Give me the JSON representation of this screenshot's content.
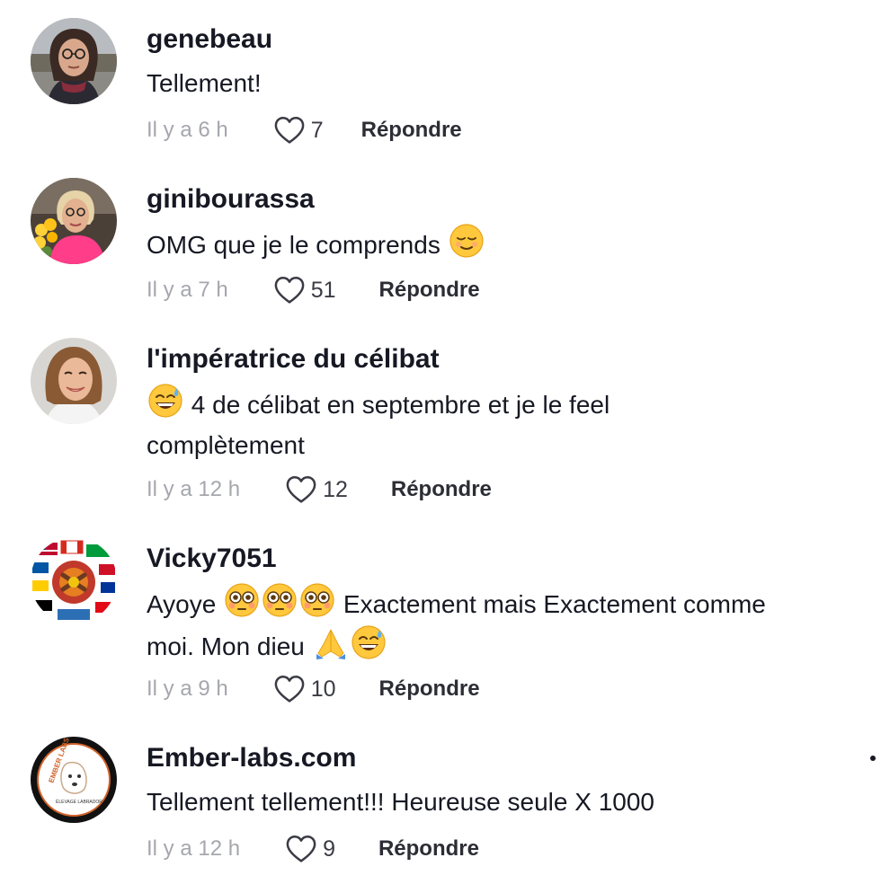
{
  "colors": {
    "text": "#161823",
    "secondary": "#a5a7ad",
    "reply": "#2c2d35"
  },
  "comments": [
    {
      "username": "genebeau",
      "text": [
        "Tellement!"
      ],
      "time": "Il y a 6 h",
      "likes": "7",
      "reply": "Répondre",
      "avatar_icon": "woman-glasses-avatar"
    },
    {
      "username": "ginibourassa",
      "text": [
        "OMG que je le comprends"
      ],
      "emoji": [
        "relieved-face-emoji"
      ],
      "time": "Il y a 7 h",
      "likes": "51",
      "reply": "Répondre",
      "avatar_icon": "woman-flowers-avatar"
    },
    {
      "username": "l'impératrice du célibat",
      "text": [
        "4 de célibat en septembre et je le feel",
        "complètement"
      ],
      "emoji": [
        "grinning-sweat-emoji"
      ],
      "time": "Il y a 12 h",
      "likes": "12",
      "reply": "Répondre",
      "avatar_icon": "smiling-woman-avatar"
    },
    {
      "username": "Vicky7051",
      "text": [
        "Ayoye",
        "Exactement mais Exactement comme",
        "moi. Mon dieu"
      ],
      "emoji": [
        "flushed-face-emoji",
        "folded-hands-emoji",
        "grinning-sweat-emoji"
      ],
      "time": "Il y a 9 h",
      "likes": "10",
      "reply": "Répondre",
      "avatar_icon": "flags-collage-avatar"
    },
    {
      "username": "Ember-labs.com",
      "text": [
        "Tellement tellement!!! Heureuse seule X 1000"
      ],
      "time": "Il y a 12 h",
      "likes": "9",
      "reply": "Répondre",
      "avatar_icon": "ember-labs-logo-avatar",
      "logo_text": [
        "EMBER LABS",
        "ÉLEVAGE LABRADOR"
      ]
    }
  ]
}
